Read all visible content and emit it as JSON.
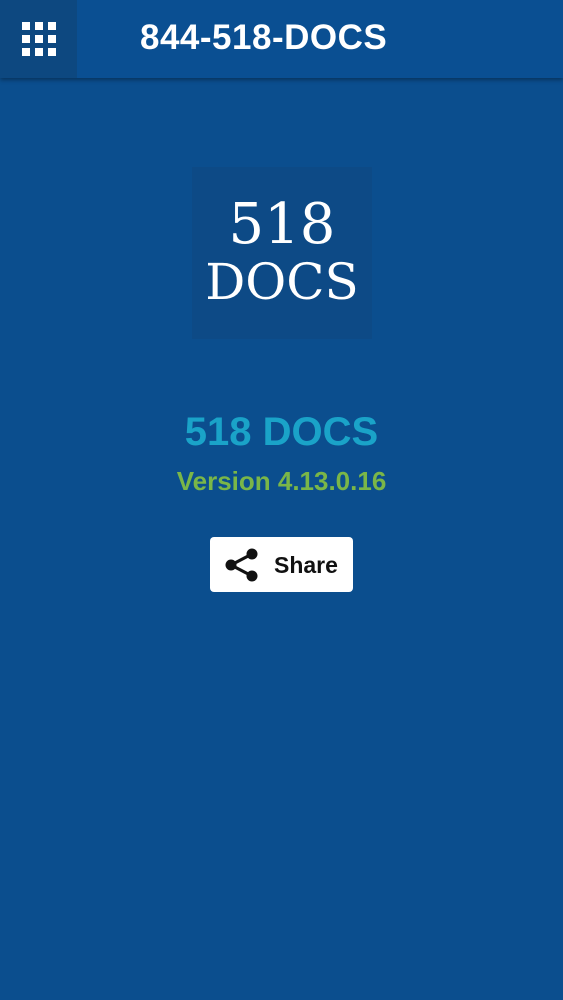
{
  "header": {
    "title": "844-518-DOCS",
    "menu_icon": "grid-menu-icon"
  },
  "about": {
    "logo_line1": "518",
    "logo_line2": "DOCS",
    "app_name": "518 DOCS",
    "version": "Version 4.13.0.16",
    "share_label": "Share",
    "share_icon": "share-icon"
  },
  "colors": {
    "background": "#0b4e8e",
    "app_bar": "#0a4f92",
    "app_name": "#1aa3c8",
    "version": "#7ab648",
    "share_button": "#ffffff"
  }
}
